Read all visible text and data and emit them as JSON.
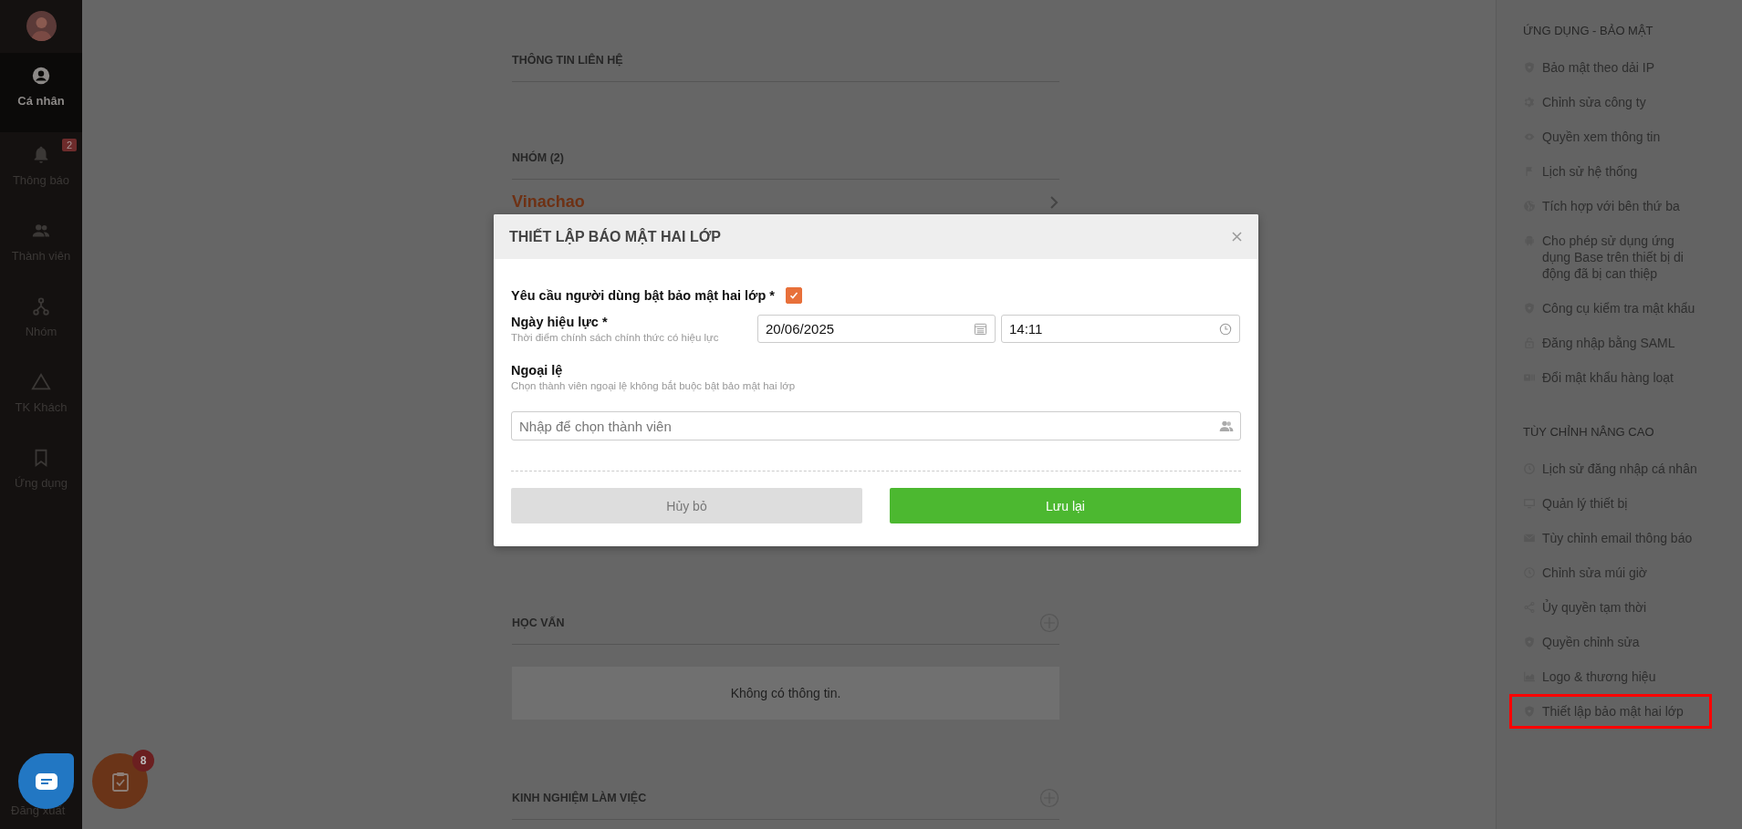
{
  "sidebar": {
    "items": [
      {
        "label": "Cá nhân",
        "selected": true
      },
      {
        "label": "Thông báo",
        "selected": false,
        "badge": "2"
      },
      {
        "label": "Thành viên",
        "selected": false
      },
      {
        "label": "Nhóm",
        "selected": false
      },
      {
        "label": "TK Khách",
        "selected": false
      },
      {
        "label": "Ứng dụng",
        "selected": false
      }
    ],
    "logout": "Đăng xuất"
  },
  "profile": {
    "sections": [
      {
        "title": "THÔNG TIN LIÊN HỆ",
        "addable": false
      },
      {
        "title": "NHÓM (2)",
        "addable": false,
        "groups": [
          "Vinachao"
        ]
      },
      {
        "title": "HỌC VẤN",
        "addable": true,
        "empty_text": "Không có thông tin."
      },
      {
        "title": "KINH NGHIỆM LÀM VIỆC",
        "addable": true
      }
    ]
  },
  "modal": {
    "title": "THIẾT LẬP BÁO MẬT HAI LỚP",
    "require_label": "Yêu cầu người dùng bật bảo mật hai lớp *",
    "require_checked": true,
    "date_label": "Ngày hiệu lực *",
    "date_hint": "Thời điểm chính sách chính thức có hiệu lực",
    "date_value": "20/06/2025",
    "time_value": "14:11",
    "exceptions_label": "Ngoại lệ",
    "exceptions_hint": "Chọn thành viên ngoại lệ không bắt buộc bật bảo mật hai lớp",
    "member_placeholder": "Nhập để chọn thành viên",
    "buttons": [
      {
        "label": "Hủy bỏ",
        "kind": "secondary"
      },
      {
        "label": "Lưu lại",
        "kind": "primary"
      }
    ]
  },
  "settings_panel": {
    "sections": [
      {
        "title": "ỨNG DỤNG - BẢO MẬT",
        "items": [
          {
            "label": "Bảo mật theo dải IP",
            "highlighted": false
          },
          {
            "label": "Chỉnh sửa công ty",
            "highlighted": false
          },
          {
            "label": "Quyền xem thông tin",
            "highlighted": false
          },
          {
            "label": "Lịch sử hệ thống",
            "highlighted": false
          },
          {
            "label": "Tích hợp với bên thứ ba",
            "highlighted": false
          },
          {
            "label": "Cho phép sử dụng ứng dụng Base trên thiết bị di động đã bị can thiệp",
            "highlighted": false
          },
          {
            "label": "Công cụ kiểm tra mật khẩu",
            "highlighted": false
          },
          {
            "label": "Đăng nhập bằng SAML",
            "highlighted": false
          },
          {
            "label": "Đổi mật khẩu hàng loạt",
            "highlighted": false
          }
        ]
      },
      {
        "title": "TÙY CHỈNH NÂNG CAO",
        "items": [
          {
            "label": "Lịch sử đăng nhập cá nhân",
            "highlighted": false
          },
          {
            "label": "Quản lý thiết bị",
            "highlighted": false
          },
          {
            "label": "Tùy chỉnh email thông báo",
            "highlighted": false
          },
          {
            "label": "Chỉnh sửa múi giờ",
            "highlighted": false
          },
          {
            "label": "Ủy quyền tạm thời",
            "highlighted": false
          },
          {
            "label": "Quyền chỉnh sửa",
            "highlighted": false
          },
          {
            "label": "Logo & thương hiệu",
            "highlighted": false
          },
          {
            "label": "Thiết lập bảo mật hai lớp",
            "highlighted": true
          }
        ]
      }
    ]
  },
  "fab": {
    "task_badge": "8"
  }
}
